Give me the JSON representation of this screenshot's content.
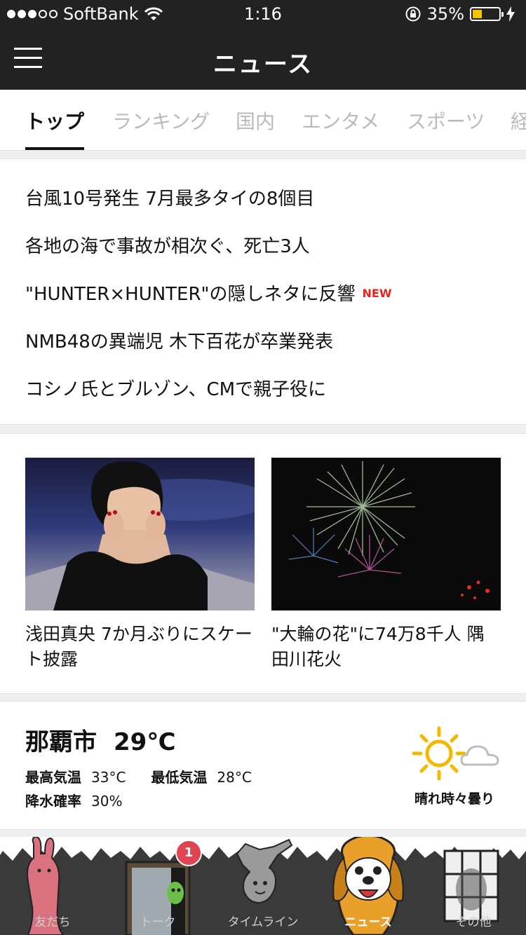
{
  "status_bar": {
    "carrier": "SoftBank",
    "signal_bars_filled": 3,
    "signal_bars_total": 5,
    "time": "1:16",
    "battery_percent_text": "35%",
    "battery_level": 0.35
  },
  "header": {
    "title": "ニュース"
  },
  "tabs": [
    {
      "label": "トップ",
      "active": true
    },
    {
      "label": "ランキング"
    },
    {
      "label": "国内"
    },
    {
      "label": "エンタメ"
    },
    {
      "label": "スポーツ"
    },
    {
      "label": "経"
    }
  ],
  "headlines": [
    {
      "text": "台風10号発生 7月最多タイの8個目"
    },
    {
      "text": "各地の海で事故が相次ぐ、死亡3人"
    },
    {
      "text": "\"HUNTER×HUNTER\"の隠しネタに反響",
      "badge": "NEW"
    },
    {
      "text": "NMB48の異端児 木下百花が卒業発表"
    },
    {
      "text": "コシノ氏とブルゾン、CMで親子役に"
    }
  ],
  "photo_news": [
    {
      "caption": "浅田真央 7か月ぶりにスケート披露"
    },
    {
      "caption": "\"大輪の花\"に74万8千人 隅田川花火"
    }
  ],
  "weather": {
    "city": "那覇市",
    "current_temp": "29℃",
    "high_label": "最高気温",
    "high_value": "33°C",
    "low_label": "最低気温",
    "low_value": "28°C",
    "precip_label": "降水確率",
    "precip_value": "30%",
    "condition": "晴れ時々曇り",
    "icon": "sun-cloud-icon"
  },
  "bottom_nav": {
    "items": [
      {
        "label": "友だち",
        "icon": "friends-character-icon"
      },
      {
        "label": "トーク",
        "icon": "talk-door-icon",
        "badge": "1"
      },
      {
        "label": "タイムライン",
        "icon": "timeline-character-icon"
      },
      {
        "label": "ニュース",
        "icon": "news-dog-icon",
        "active": true
      },
      {
        "label": "その他",
        "icon": "more-window-icon"
      }
    ]
  },
  "colors": {
    "header_bg": "#222222",
    "accent_red": "#e8231f",
    "badge_red": "#e04452",
    "sun_yellow": "#f5b800",
    "battery_fill": "#f5c400"
  }
}
